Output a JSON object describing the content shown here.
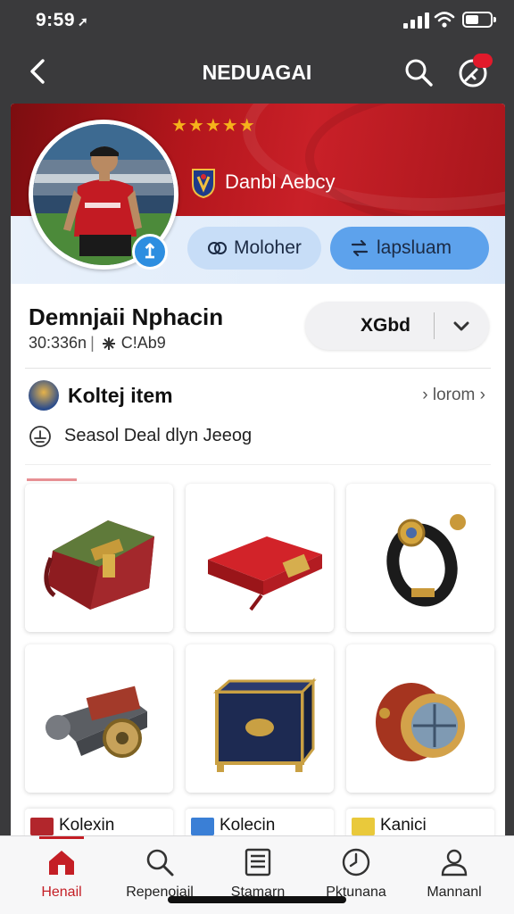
{
  "status": {
    "time": "9:59",
    "arrow": "➚"
  },
  "nav": {
    "title": "NEDUAGAI"
  },
  "banner": {
    "stars": "★★★★★",
    "team_name": "Danbl Aebcy"
  },
  "actions": {
    "pill_1": "Moloher",
    "pill_2": "lapsluam"
  },
  "profile": {
    "name": "Demnjaii Nphacin",
    "stat_1": "30:336n",
    "stat_2": "C!Ab9"
  },
  "follow": {
    "label": "XGbd"
  },
  "collection": {
    "title": "Koltej item",
    "more": "lorom"
  },
  "season": {
    "text": "Seasol Deal dlyn Jeeog"
  },
  "items": [
    {
      "icon": "bag-icon"
    },
    {
      "icon": "wallet-icon"
    },
    {
      "icon": "ring-icon"
    },
    {
      "icon": "cannon-icon"
    },
    {
      "icon": "chest-icon"
    },
    {
      "icon": "orb-icon"
    }
  ],
  "mini_cards": [
    {
      "label": "Kolexin"
    },
    {
      "label": "Kolecin"
    },
    {
      "label": "Kanici"
    }
  ],
  "tabs": [
    {
      "label": "Henail",
      "icon": "home-icon",
      "active": true
    },
    {
      "label": "Repenoiail",
      "icon": "search-icon"
    },
    {
      "label": "Stamarn",
      "icon": "list-icon"
    },
    {
      "label": "Pktunana",
      "icon": "clock-icon"
    },
    {
      "label": "Mannanl",
      "icon": "user-icon"
    }
  ],
  "colors": {
    "accent": "#c41e25",
    "banner": "#b3161c",
    "pill_primary": "#5da2ec",
    "pill_secondary": "#c7ddf7"
  }
}
